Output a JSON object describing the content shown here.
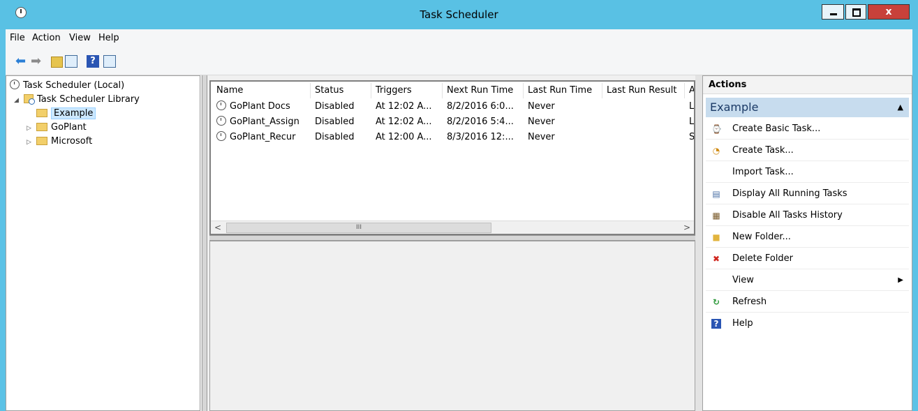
{
  "window": {
    "title": "Task Scheduler",
    "close_label": "x"
  },
  "menu": [
    "File",
    "Action",
    "View",
    "Help"
  ],
  "toolbar": {
    "help_glyph": "?"
  },
  "tree": {
    "root": "Task Scheduler (Local)",
    "library": "Task Scheduler Library",
    "folders": [
      "Example",
      "GoPlant",
      "Microsoft"
    ]
  },
  "tasks": {
    "columns": [
      "Name",
      "Status",
      "Triggers",
      "Next Run Time",
      "Last Run Time",
      "Last Run Result",
      "A"
    ],
    "rows": [
      {
        "name": "GoPlant Docs",
        "status": "Disabled",
        "triggers": "At 12:02 A...",
        "next_run": "8/2/2016 6:0...",
        "last_run": "Never",
        "overflow": "L"
      },
      {
        "name": "GoPlant_Assign",
        "status": "Disabled",
        "triggers": "At 12:02 A...",
        "next_run": "8/2/2016 5:4...",
        "last_run": "Never",
        "overflow": "L"
      },
      {
        "name": "GoPlant_Recur",
        "status": "Disabled",
        "triggers": "At 12:00 A...",
        "next_run": "8/3/2016 12:...",
        "last_run": "Never",
        "overflow": "S"
      }
    ],
    "scroll": {
      "left": "<",
      "right": ">",
      "grip": "III"
    }
  },
  "actions": {
    "header": "Actions",
    "section": "Example",
    "items": [
      {
        "label": "Create Basic Task...",
        "icon": "create-basic-task-icon",
        "glyph": "⌚"
      },
      {
        "label": "Create Task...",
        "icon": "create-task-icon",
        "glyph": "◔"
      },
      {
        "label": "Import Task...",
        "icon": "",
        "glyph": ""
      },
      {
        "label": "Display All Running Tasks",
        "icon": "running-tasks-icon",
        "glyph": "▤"
      },
      {
        "label": "Disable All Tasks History",
        "icon": "tasks-history-icon",
        "glyph": "▦"
      },
      {
        "label": "New Folder...",
        "icon": "new-folder-icon",
        "glyph": "■"
      },
      {
        "label": "Delete Folder",
        "icon": "delete-icon",
        "glyph": "✖"
      },
      {
        "label": "View",
        "icon": "",
        "glyph": "",
        "submenu": "▶"
      },
      {
        "label": "Refresh",
        "icon": "refresh-icon",
        "glyph": "↻"
      },
      {
        "label": "Help",
        "icon": "help-icon",
        "glyph": "?"
      }
    ]
  },
  "colors": {
    "titlebar": "#59c1e4",
    "selection": "#cce8ff",
    "close": "#c8413a",
    "section": "#c7dcee"
  }
}
